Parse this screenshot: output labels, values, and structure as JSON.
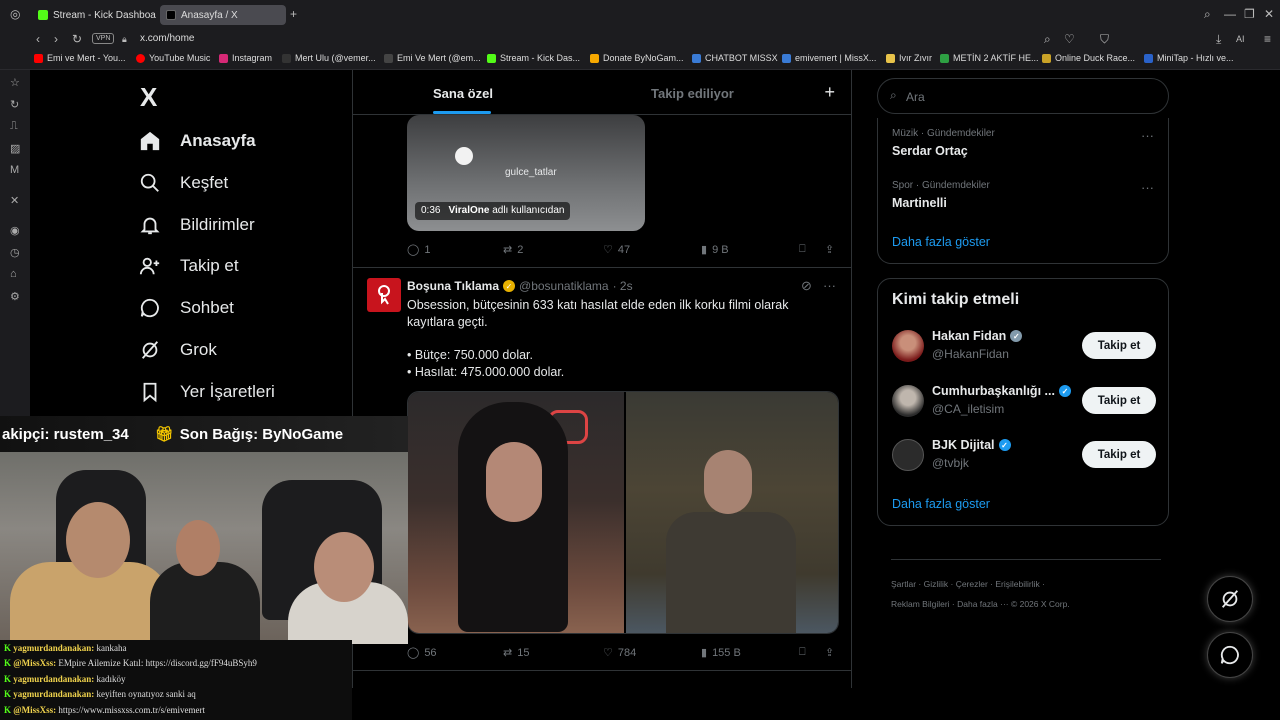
{
  "browser": {
    "tabs": [
      {
        "label": "Stream - Kick Dashboard",
        "active": false
      },
      {
        "label": "Anasayfa / X",
        "active": true
      }
    ],
    "new_tab": "+",
    "vpn": "VPN",
    "url": "x.com/home",
    "bookmarks": [
      "Emi ve Mert - You...",
      "YouTube Music",
      "Instagram",
      "Mert Ulu (@vemer...",
      "Emi Ve Mert (@em...",
      "Stream - Kick Das...",
      "Donate ByNoGam...",
      "CHATBOT MISSX",
      "emivemert | MissX...",
      "Ivır Zıvır",
      "METİN 2 AKTİF HE...",
      "Online Duck Race...",
      "MiniTap - Hızlı ve..."
    ]
  },
  "nav": {
    "logo": "X",
    "items": [
      {
        "label": "Anasayfa",
        "icon": "home-icon"
      },
      {
        "label": "Keşfet",
        "icon": "search-icon"
      },
      {
        "label": "Bildirimler",
        "icon": "bell-icon"
      },
      {
        "label": "Takip et",
        "icon": "person-add-icon"
      },
      {
        "label": "Sohbet",
        "icon": "chat-icon"
      },
      {
        "label": "Grok",
        "icon": "grok-icon"
      },
      {
        "label": "Yer İşaretleri",
        "icon": "bookmark-icon"
      }
    ]
  },
  "feed": {
    "tabs": [
      "Sana özel",
      "Takip ediliyor"
    ],
    "plus": "+",
    "prev_tweet": {
      "watermark": "gulce_tatlar",
      "video_time": "0:36",
      "video_source_name": "ViralOne",
      "video_source_suffix": "adlı kullanıcıdan",
      "replies": "1",
      "retweets": "2",
      "likes": "47",
      "views": "9 B"
    },
    "tweet": {
      "name": "Boşuna Tıklama",
      "handle": "@bosunatiklama",
      "time": "· 2s",
      "text_1": "Obsession, bütçesinin 633 katı hasılat elde eden ilk korku filmi olarak kayıtlara geçti.",
      "text_2": "• Bütçe: 750.000 dolar.",
      "text_3": "• Hasılat: 475.000.000 dolar.",
      "replies": "56",
      "retweets": "15",
      "likes": "784",
      "views": "155 B"
    }
  },
  "right": {
    "search_placeholder": "Ara",
    "trends": [
      {
        "category": "Müzik · Gündemdekiler",
        "name": "Serdar Ortaç"
      },
      {
        "category": "Spor · Gündemdekiler",
        "name": "Martinelli"
      }
    ],
    "trends_show_more": "Daha fazla göster",
    "who_title": "Kimi takip etmeli",
    "who": [
      {
        "name": "Hakan Fidan",
        "handle": "@HakanFidan",
        "badge_color": "#829aab",
        "button": "Takip et"
      },
      {
        "name": "Cumhurbaşkanlığı ...",
        "handle": "@CA_iletisim",
        "badge_color": "#1d9bf0",
        "button": "Takip et"
      },
      {
        "name": "BJK Dijital",
        "handle": "@tvbjk",
        "badge_color": "#1d9bf0",
        "button": "Takip et"
      }
    ],
    "who_show_more": "Daha fazla göster",
    "footer_1": "Şartlar  ·  Gizlilik  ·  Çerezler  ·  Erişilebilirlik  ·",
    "footer_2": "Reklam Bilgileri  ·  Daha fazla ···  © 2026 X Corp."
  },
  "overlay": {
    "banner_left": "akipçi: rustem_34",
    "banner_right": "Son Bağış: ByNoGame",
    "chat": [
      {
        "user": "yagmurdandanakan:",
        "msg": "kankaha"
      },
      {
        "user": "@MissXss:",
        "msg": "EMpire Ailemize Katıl: https://discord.gg/fF94uBSyh9"
      },
      {
        "user": "yagmurdandanakan:",
        "msg": "kadıköy"
      },
      {
        "user": "yagmurdandanakan:",
        "msg": "keyiften oynatıyoz sanki aq"
      },
      {
        "user": "@MissXss:",
        "msg": "https://www.missxss.com.tr/s/emivemert"
      }
    ]
  },
  "colors": {
    "accent": "#1d9bf0",
    "kick": "#53fc18"
  }
}
